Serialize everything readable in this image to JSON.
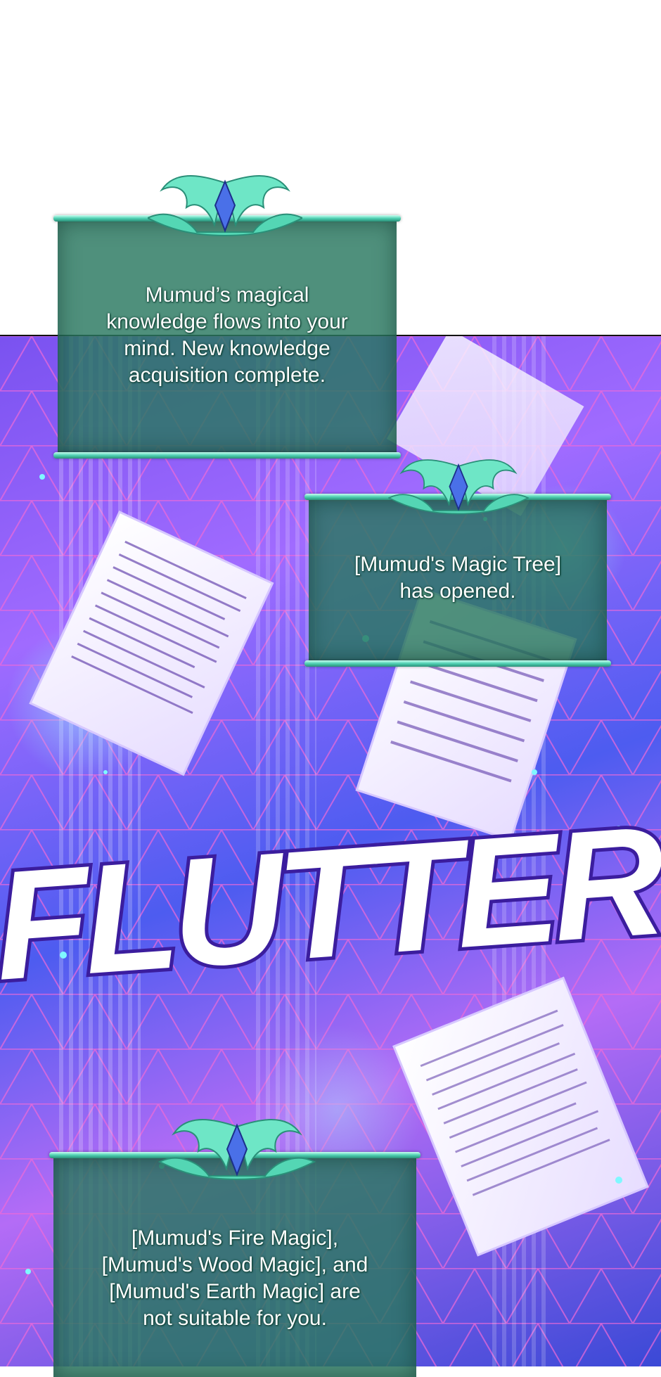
{
  "panel": {
    "notifications": [
      {
        "lines": [
          "Mumud’s magical",
          "knowledge flows into your",
          "mind. New knowledge",
          "acquisition complete."
        ]
      },
      {
        "lines": [
          "[Mumud's Magic Tree]",
          "has opened."
        ]
      },
      {
        "lines": [
          "[Mumud's Fire Magic],",
          "[Mumud's Wood Magic], and",
          "[Mumud's Earth Magic] are",
          "not suitable for you."
        ]
      }
    ],
    "sfx": "FLUTTER"
  },
  "colors": {
    "window_fill": "#2d7a63",
    "window_rod": "#4fd0b2",
    "ornament": "#6ee6c6",
    "gem": "#4a70e8",
    "background": "#7a52f0"
  },
  "icons": {
    "ornament": "winged-crest-icon",
    "gem": "blue-diamond-icon"
  }
}
